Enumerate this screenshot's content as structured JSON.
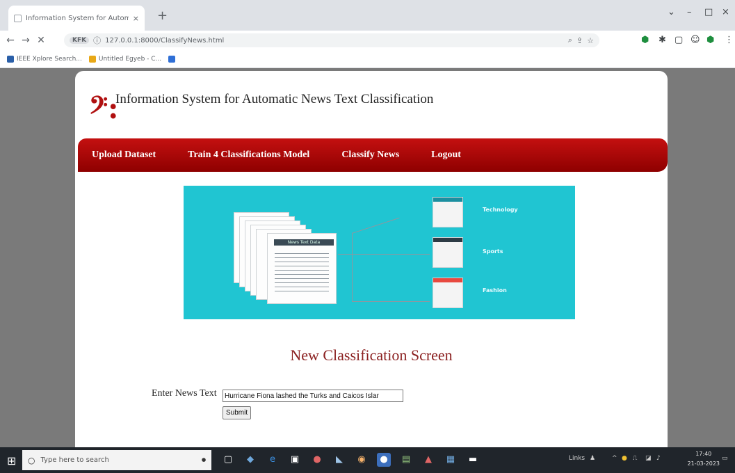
{
  "browser": {
    "tab_title": "Information System for Automat",
    "tab_close": "×",
    "new_tab": "+",
    "url_chip": "KFK",
    "url": "127.0.0.1:8000/ClassifyNews.html",
    "window_controls": {
      "chevron": "⌄",
      "minimize": "–",
      "maximize": "□",
      "close": "×"
    },
    "bookmarks": [
      {
        "label": "IEEE Xplore Search...",
        "color": "#2a5fa8"
      },
      {
        "label": "Untitled Egyeb - C...",
        "color": "#e8a817"
      },
      {
        "label": "",
        "color": "#2f6fd6"
      }
    ]
  },
  "site": {
    "logo_glyph": "𝄢:",
    "title": "Information System for Automatic News Text Classification",
    "menu": [
      {
        "label": "Upload Dataset"
      },
      {
        "label": "Train 4 Classifications Model"
      },
      {
        "label": "Classify News"
      },
      {
        "label": "Logout"
      }
    ]
  },
  "banner": {
    "doc_label": "News Text Data",
    "categories": [
      {
        "label": "Technology",
        "color": "#1b8fa0"
      },
      {
        "label": "Sports",
        "color": "#2d3b45"
      },
      {
        "label": "Fashion",
        "color": "#e8493f"
      }
    ],
    "background": "#20c5d2"
  },
  "form": {
    "section_title": "New Classification Screen",
    "label": "Enter News Text",
    "input_value": "Hurricane Fiona lashed the Turks and Caicos Islar",
    "submit_label": "Submit"
  },
  "taskbar": {
    "search_placeholder": "Type here to search",
    "tray_text": "Links",
    "time": "17:40",
    "date": "21-03-2023"
  },
  "colors": {
    "menu_red": "#b00e0e",
    "title_red": "#8b2020",
    "banner_cyan": "#20c5d2"
  }
}
